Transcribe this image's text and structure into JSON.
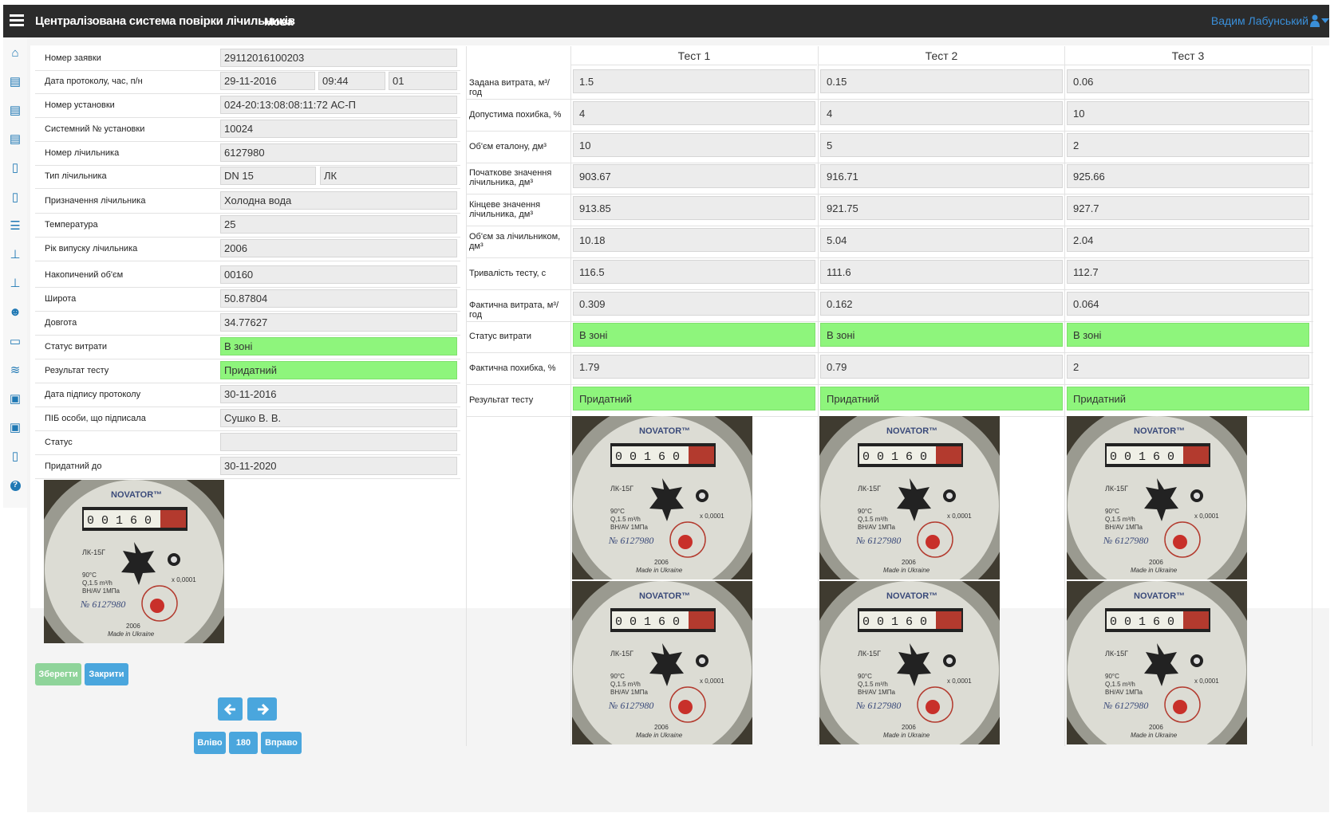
{
  "app": {
    "title": "Централізована система повірки лічильників",
    "lang_label": "Мова",
    "user_name": "Вадим Лабунський"
  },
  "colors": {
    "topbar": "#2b2b2b",
    "accent": "#3a8fd9",
    "ok_green": "#8ef57c",
    "nav_icon": "#1f78b4"
  },
  "sidebar": {
    "icons": [
      "home-icon",
      "list-icon",
      "list-icon",
      "list-icon",
      "document-icon",
      "document-icon",
      "stack-icon",
      "pin-icon",
      "pin-icon",
      "users-icon",
      "monitor-icon",
      "database-icon",
      "archive-icon",
      "archive-icon",
      "excel-file-icon",
      "help-icon"
    ]
  },
  "form": {
    "rows": [
      {
        "label": "Номер заявки",
        "values": [
          "29112016100203"
        ]
      },
      {
        "label": "Дата протоколу, час, п/н",
        "values": [
          "29-11-2016",
          "09:44",
          "01"
        ]
      },
      {
        "label": "Номер установки",
        "values": [
          "024-20:13:08:08:11:72 АС-П"
        ]
      },
      {
        "label": "Системний № установки",
        "values": [
          "10024"
        ]
      },
      {
        "label": "Номер лічильника",
        "values": [
          "6127980"
        ]
      },
      {
        "label": "Тип лічильника",
        "values": [
          "DN 15",
          "ЛК"
        ]
      },
      {
        "label": "Призначення лічильника",
        "values": [
          "Холодна вода"
        ]
      },
      {
        "label": "Температура",
        "values": [
          "25"
        ]
      },
      {
        "label": "Рік випуску лічильника",
        "values": [
          "2006"
        ]
      },
      {
        "label": "Накопичений об'єм",
        "values": [
          "00160"
        ]
      },
      {
        "label": "Широта",
        "values": [
          "50.87804"
        ]
      },
      {
        "label": "Довгота",
        "values": [
          "34.77627"
        ]
      },
      {
        "label": "Статус витрати",
        "values": [
          "В зоні"
        ],
        "green": true
      },
      {
        "label": "Результат тесту",
        "values": [
          "Придатний"
        ],
        "green": true
      },
      {
        "label": "Дата підпису протоколу",
        "values": [
          "30-11-2016"
        ]
      },
      {
        "label": "ПІБ особи, що підписала",
        "values": [
          "Сушко В. В."
        ]
      },
      {
        "label": "Статус",
        "values": [
          ""
        ]
      },
      {
        "label": "Придатний до",
        "values": [
          "30-11-2020"
        ]
      }
    ]
  },
  "tests": {
    "headers": [
      "Тест 1",
      "Тест 2",
      "Тест 3"
    ],
    "rows": [
      {
        "label": "Задана витрата, м³/год",
        "values": [
          "1.5",
          "0.15",
          "0.06"
        ]
      },
      {
        "label": "Допустима похибка, %",
        "values": [
          "4",
          "4",
          "10"
        ]
      },
      {
        "label": "Об'єм еталону, дм³",
        "values": [
          "10",
          "5",
          "2"
        ]
      },
      {
        "label": "Початкове значення лічильника, дм³",
        "values": [
          "903.67",
          "916.71",
          "925.66"
        ]
      },
      {
        "label": "Кінцеве значення лічильника, дм³",
        "values": [
          "913.85",
          "921.75",
          "927.7"
        ]
      },
      {
        "label": "Об'єм за лічильником, дм³",
        "values": [
          "10.18",
          "5.04",
          "2.04"
        ]
      },
      {
        "label": "Тривалість тесту, с",
        "values": [
          "116.5",
          "111.6",
          "112.7"
        ]
      },
      {
        "label": "Фактична витрата, м³/год",
        "values": [
          "0.309",
          "0.162",
          "0.064"
        ]
      },
      {
        "label": "Статус витрати",
        "values": [
          "В зоні",
          "В зоні",
          "В зоні"
        ],
        "green": true
      },
      {
        "label": "Фактична похибка, %",
        "values": [
          "1.79",
          "0.79",
          "2"
        ]
      },
      {
        "label": "Результат тесту",
        "values": [
          "Придатний",
          "Придатний",
          "Придатний"
        ],
        "green": true
      }
    ]
  },
  "meter_photo": {
    "brand": "NOVATOR™",
    "reading": "0 0 1 6 0",
    "model": "ЛК-15Г",
    "specs": "90°C Q,1.5 m³/h BH/AV 1MПа",
    "multiplier": "x 0,0001",
    "serial": "№ 6127980",
    "year": "2006",
    "made": "Made in Ukraine"
  },
  "buttons": {
    "save": "Зберегти",
    "close": "Закрити",
    "prev_icon": "arrow-left-icon",
    "next_icon": "arrow-right-icon",
    "rotate_left": "Вліво",
    "rotate_180": "180",
    "rotate_right": "Вправо"
  }
}
